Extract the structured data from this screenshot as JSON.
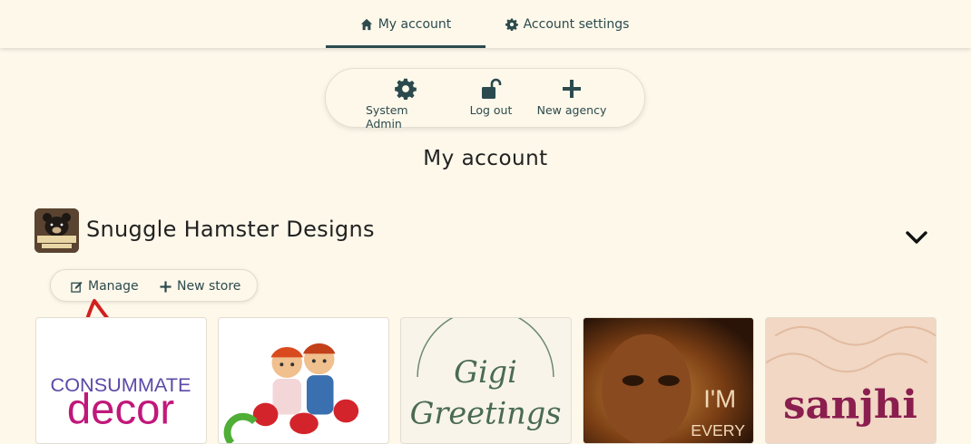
{
  "nav": {
    "tabs": [
      {
        "label": "My account",
        "icon": "home-icon",
        "active": true
      },
      {
        "label": "Account settings",
        "icon": "gear-icon",
        "active": false
      }
    ]
  },
  "actions": {
    "system_admin": {
      "label": "System Admin",
      "icon": "gear-icon"
    },
    "log_out": {
      "label": "Log out",
      "icon": "unlock-icon"
    },
    "new_agency": {
      "label": "New agency",
      "icon": "plus-icon"
    }
  },
  "page": {
    "title": "My account"
  },
  "agency": {
    "name": "Snuggle Hamster Designs",
    "logo_text": "SNUGGLE HAMSTER DESIGNS",
    "manage_label": "Manage",
    "new_store_label": "New store"
  },
  "stores": [
    {
      "logo_text_1": "CONSUMMATE",
      "logo_text_2": "decor"
    },
    {
      "logo_text_1": ""
    },
    {
      "logo_text_1": "Gigi",
      "logo_text_2": "Greetings"
    },
    {
      "logo_text_1": "I'M",
      "logo_text_2": "EVERY"
    },
    {
      "logo_text_1": "sanjhi"
    }
  ],
  "colors": {
    "background": "#fdf8ea",
    "accent": "#2b4a4e",
    "annotation": "#d22020"
  }
}
